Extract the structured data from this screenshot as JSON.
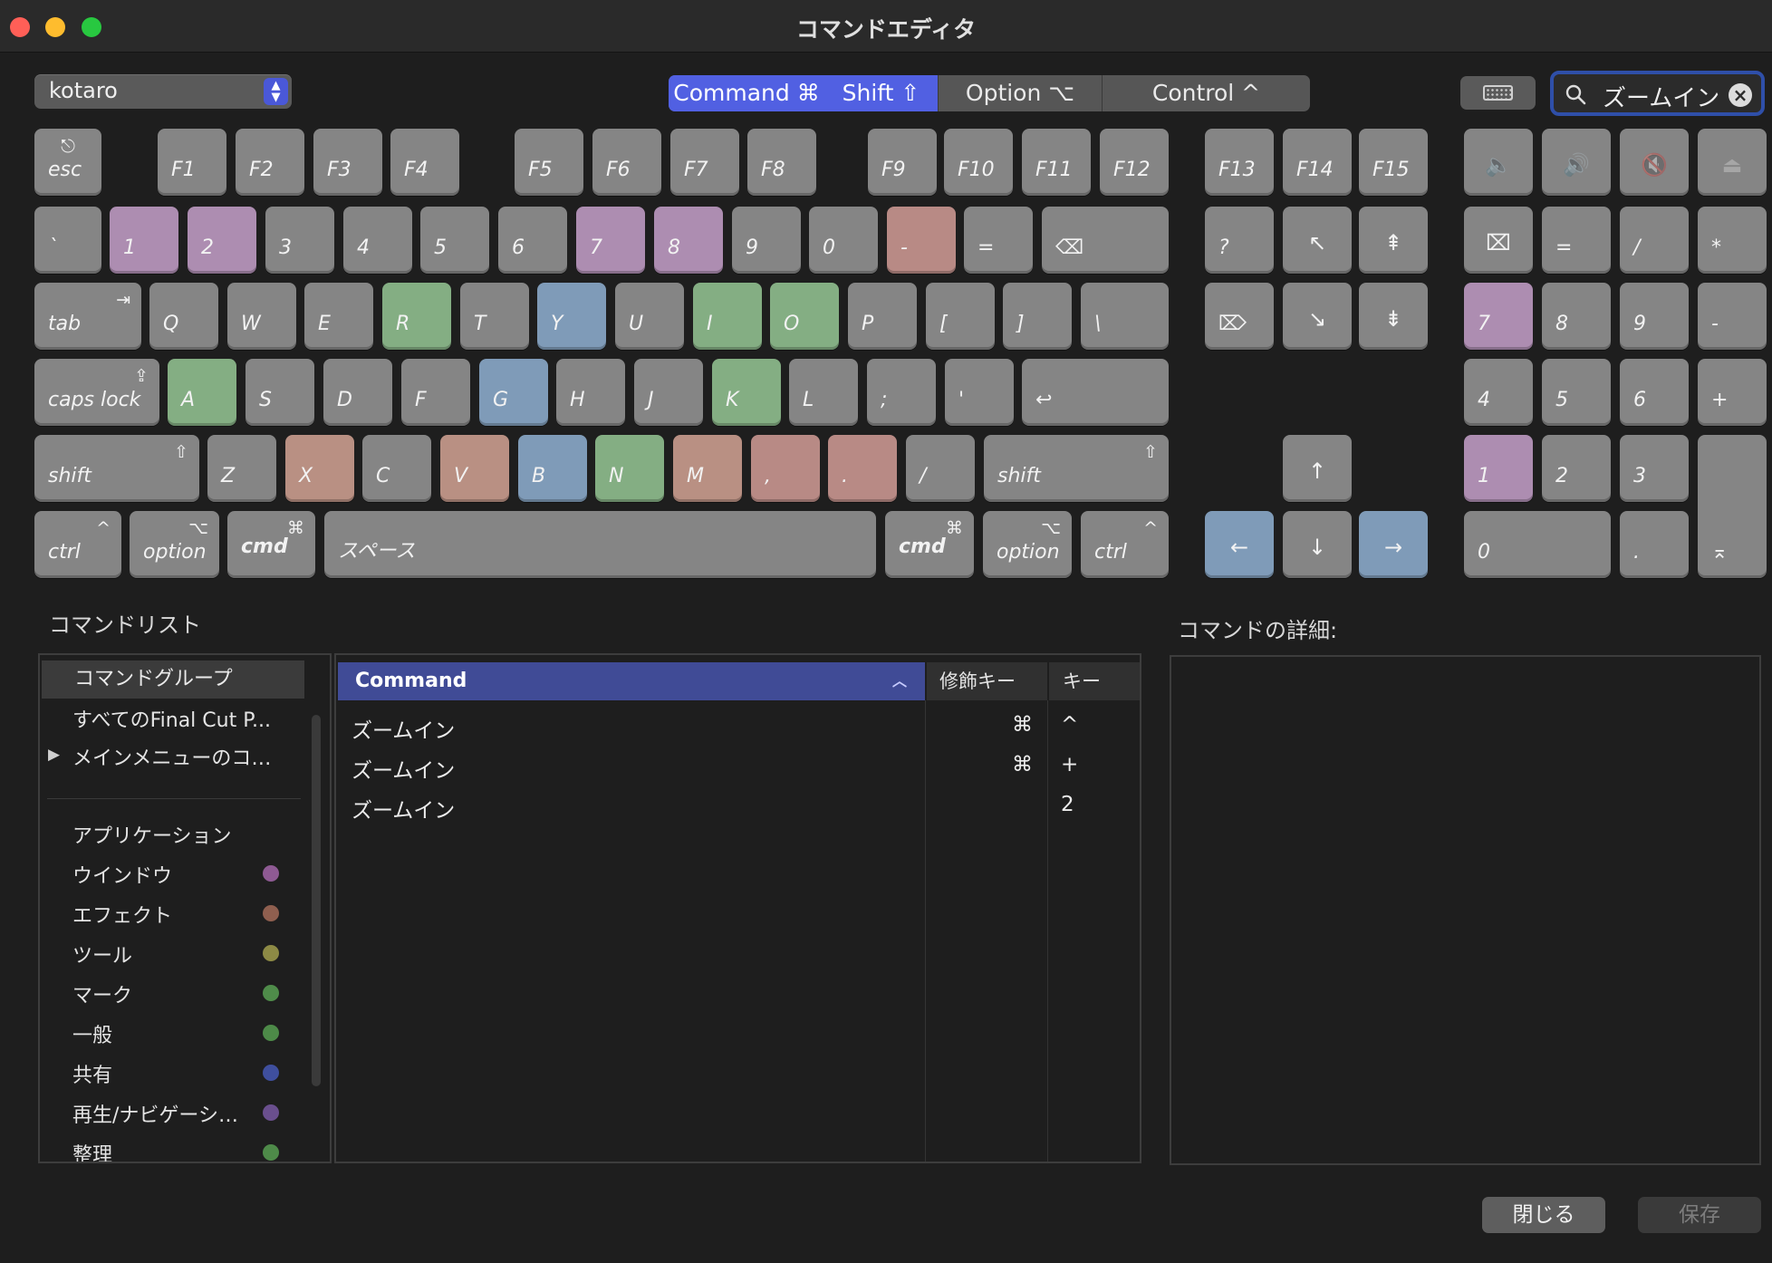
{
  "window": {
    "title": "コマンドエディタ"
  },
  "toolbar": {
    "preset": "kotaro",
    "modifiers": [
      {
        "label": "Command ⌘",
        "active": true
      },
      {
        "label": "Shift ⇧",
        "active": true
      },
      {
        "label": "Option ⌥",
        "active": false
      },
      {
        "label": "Control ^",
        "active": false
      }
    ],
    "keyboard_icon": "keyboard-icon",
    "search": {
      "value": "ズームイン",
      "icon": "search-icon",
      "clear_icon": "clear-icon"
    }
  },
  "keyboard": {
    "fn_row": {
      "esc": {
        "label": "esc",
        "symbol": "⎋"
      },
      "keys": [
        "F1",
        "F2",
        "F3",
        "F4",
        "F5",
        "F6",
        "F7",
        "F8",
        "F9",
        "F10",
        "F11",
        "F12",
        "F13",
        "F14",
        "F15"
      ],
      "media": [
        "🔈",
        "🔊",
        "🔇",
        "⏏"
      ]
    },
    "number_row": [
      "`",
      "1",
      "2",
      "3",
      "4",
      "5",
      "6",
      "7",
      "8",
      "9",
      "0",
      "-",
      "="
    ],
    "delete": "⌫",
    "tab": {
      "label": "tab",
      "symbol": "⇥"
    },
    "qwerty": [
      "Q",
      "W",
      "E",
      "R",
      "T",
      "Y",
      "U",
      "I",
      "O",
      "P",
      "[",
      "]",
      "\\"
    ],
    "caps": {
      "label": "caps lock",
      "symbol": "⇪"
    },
    "home_row": [
      "A",
      "S",
      "D",
      "F",
      "G",
      "H",
      "J",
      "K",
      "L",
      ";",
      "'"
    ],
    "return": "↩",
    "shift": {
      "label": "shift",
      "symbol": "⇧"
    },
    "bottom_row": [
      "Z",
      "X",
      "C",
      "V",
      "B",
      "N",
      "M",
      ",",
      ".",
      "/"
    ],
    "ctrl": {
      "label": "ctrl",
      "symbol": "^"
    },
    "option": {
      "label": "option",
      "symbol": "⌥"
    },
    "cmd": {
      "label": "cmd",
      "symbol": "⌘"
    },
    "space": "スペース",
    "nav": {
      "help": "?",
      "home": "↖",
      "pgup": "⇞",
      "fwd_del": "⌦",
      "end": "↘",
      "pgdn": "⇟"
    },
    "arrows": {
      "up": "↑",
      "left": "←",
      "down": "↓",
      "right": "→"
    },
    "numpad": {
      "row1": [
        "⌧",
        "=",
        "/",
        "*"
      ],
      "row2": [
        "7",
        "8",
        "9",
        "-"
      ],
      "row3": [
        "4",
        "5",
        "6",
        "+"
      ],
      "row4": [
        "1",
        "2",
        "3"
      ],
      "row5": [
        "0",
        "."
      ],
      "enter": "⌅"
    },
    "highlight_colors": {
      "purple": "#ad8db1",
      "green": "#84ae83",
      "blue": "#7f9bb8",
      "salmon": "#b88a85",
      "peach": "#b99083"
    }
  },
  "command_list": {
    "title": "コマンドリスト",
    "groups_header": "コマンドグループ",
    "groups": [
      {
        "name": "すべてのFinal Cut P...",
        "expandable": false
      },
      {
        "name": "メインメニューのコ…",
        "expandable": true
      },
      {
        "name": "アプリケーション",
        "color": ""
      },
      {
        "name": "ウインドウ",
        "color": "#8e5a93"
      },
      {
        "name": "エフェクト",
        "color": "#8f5f4f"
      },
      {
        "name": "ツール",
        "color": "#8d8a45"
      },
      {
        "name": "マーク",
        "color": "#4f8c4a"
      },
      {
        "name": "一般",
        "color": "#4d8a48"
      },
      {
        "name": "共有",
        "color": "#3f4f9e"
      },
      {
        "name": "再生/ナビゲーシ…",
        "color": "#6a4f8e"
      },
      {
        "name": "整理",
        "color": "#4e8a49"
      }
    ],
    "columns": {
      "command": "Command",
      "modifier": "修飾キー",
      "key": "キー"
    },
    "rows": [
      {
        "command": "ズームイン",
        "modifier": "⌘",
        "key": "^"
      },
      {
        "command": "ズームイン",
        "modifier": "⌘",
        "key": "+"
      },
      {
        "command": "ズームイン",
        "modifier": "",
        "key": "2"
      }
    ]
  },
  "details": {
    "title": "コマンドの詳細:"
  },
  "buttons": {
    "close": "閉じる",
    "save": "保存"
  }
}
